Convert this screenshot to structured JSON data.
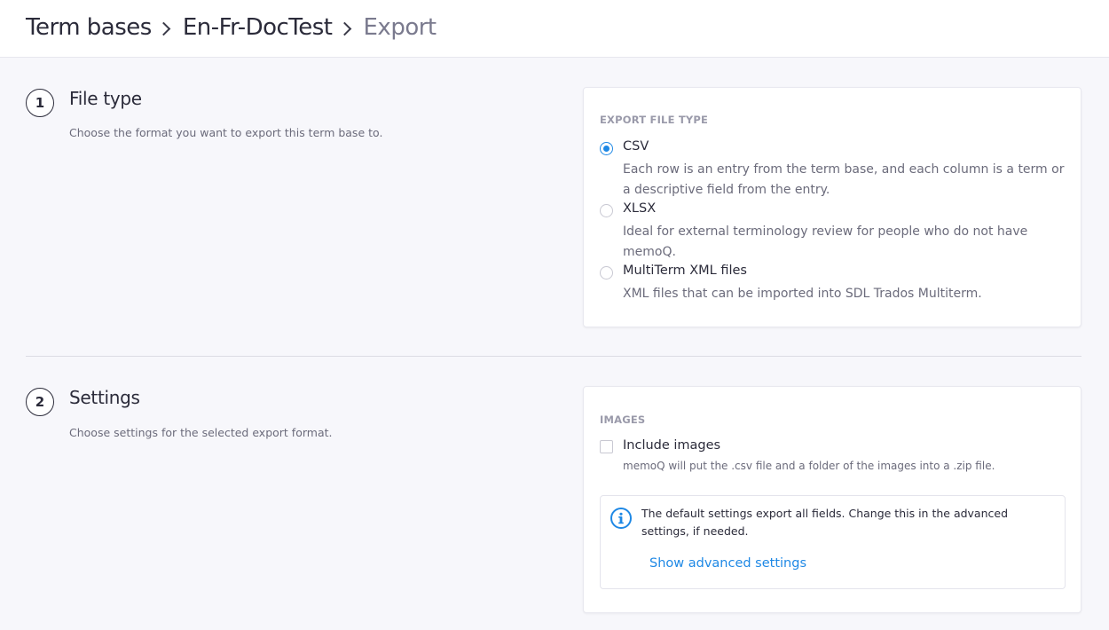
{
  "breadcrumb": {
    "items": [
      "Term bases",
      "En-Fr-DocTest"
    ],
    "current": "Export"
  },
  "sections": {
    "file_type": {
      "step": "1",
      "title": "File type",
      "description": "Choose the format you want to export this term base to.",
      "card": {
        "label": "EXPORT FILE TYPE",
        "selected": "CSV",
        "options": [
          {
            "label": "CSV",
            "description": "Each row is an entry from the term base, and each column is a term or a descriptive field from the entry."
          },
          {
            "label": "XLSX",
            "description": "Ideal for external terminology review for people who do not have memoQ."
          },
          {
            "label": "MultiTerm XML files",
            "description": "XML files that can be imported into SDL Trados Multiterm."
          }
        ]
      }
    },
    "settings": {
      "step": "2",
      "title": "Settings",
      "description": "Choose settings for the selected export format.",
      "card": {
        "label": "IMAGES",
        "include_images": {
          "label": "Include images",
          "checked": false,
          "description": "memoQ will put the .csv file and a folder of the images into a .zip file."
        },
        "info": {
          "text": "The default settings export all fields. Change this in the advanced settings, if needed.",
          "link": "Show advanced settings"
        }
      }
    }
  },
  "colors": {
    "accent": "#1e88e5",
    "background": "#f7f7fb",
    "card": "#ffffff",
    "muted_text": "#6b6b7b"
  }
}
